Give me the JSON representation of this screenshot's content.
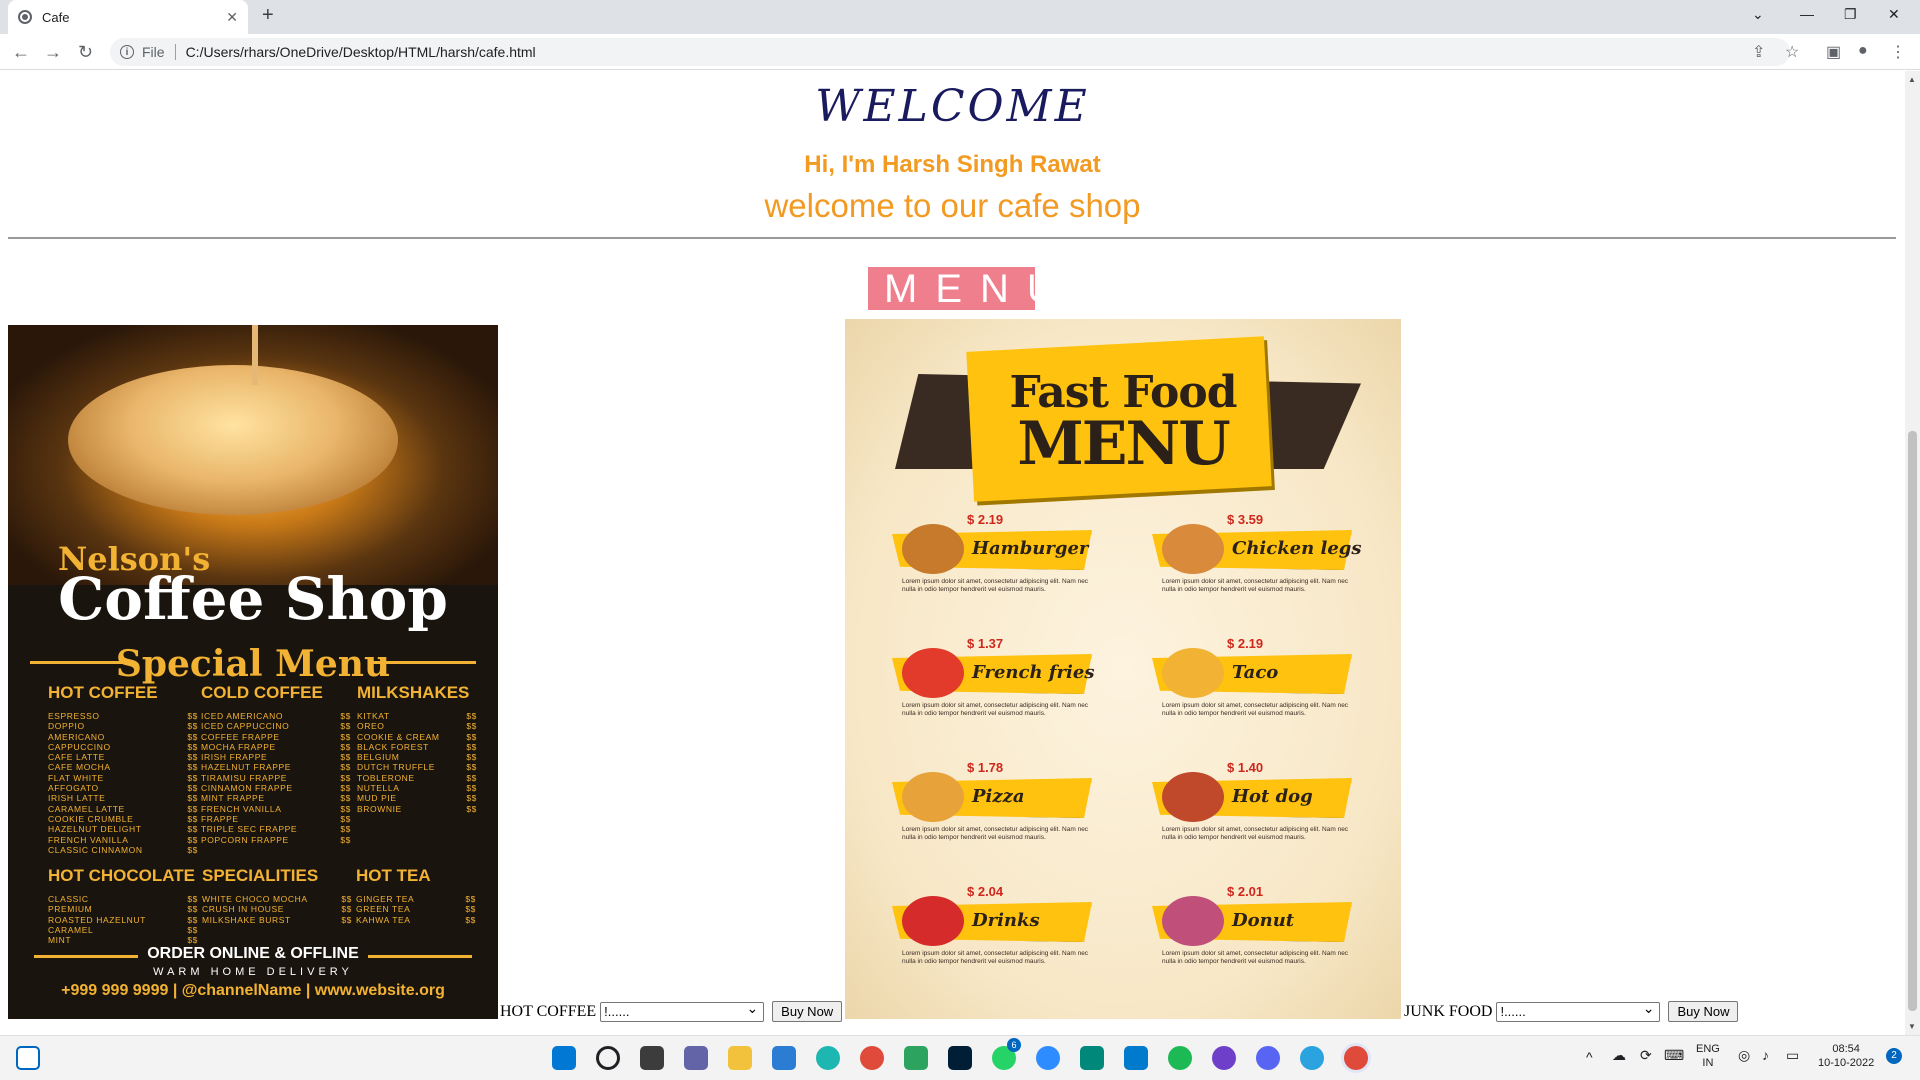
{
  "browser": {
    "tab_title": "Cafe",
    "new_tab": "+",
    "address_scheme": "File",
    "address_url": "C:/Users/rhars/OneDrive/Desktop/HTML/harsh/cafe.html"
  },
  "page": {
    "welcome": "WELCOME",
    "greeting": "Hi, I'm Harsh Singh Rawat",
    "subtitle": "welcome to our cafe shop",
    "menu_heading": "MENU"
  },
  "coffee_poster": {
    "brand": "Nelson's",
    "title": "Coffee Shop",
    "special": "Special Menu",
    "sections": [
      {
        "heading": "HOT COFFEE",
        "items": [
          "ESPRESSO",
          "DOPPIO",
          "AMERICANO",
          "CAPPUCCINO",
          "CAFE LATTE",
          "CAFE MOCHA",
          "FLAT WHITE",
          "AFFOGATO",
          "IRISH LATTE",
          "CARAMEL LATTE",
          "COOKIE CRUMBLE",
          "HAZELNUT DELIGHT",
          "FRENCH VANILLA",
          "CLASSIC CINNAMON"
        ]
      },
      {
        "heading": "COLD COFFEE",
        "items": [
          "ICED AMERICANO",
          "ICED CAPPUCCINO",
          "COFFEE FRAPPE",
          "MOCHA FRAPPE",
          "IRISH FRAPPE",
          "HAZELNUT FRAPPE",
          "TIRAMISU FRAPPE",
          "CINNAMON FRAPPE",
          "MINT FRAPPE",
          "FRENCH VANILLA",
          "FRAPPE",
          "TRIPLE SEC FRAPPE",
          "POPCORN FRAPPE"
        ]
      },
      {
        "heading": "MILKSHAKES",
        "items": [
          "KITKAT",
          "OREO",
          "COOKIE & CREAM",
          "BLACK FOREST",
          "BELGIUM",
          "DUTCH TRUFFLE",
          "TOBLERONE",
          "NUTELLA",
          "MUD PIE",
          "BROWNIE"
        ]
      },
      {
        "heading": "HOT CHOCOLATE",
        "items": [
          "CLASSIC",
          "PREMIUM",
          "ROASTED HAZELNUT",
          "CARAMEL",
          "MINT"
        ]
      },
      {
        "heading": "SPECIALITIES",
        "items": [
          "WHITE CHOCO MOCHA",
          "CRUSH IN HOUSE",
          "MILKSHAKE BURST"
        ]
      },
      {
        "heading": "HOT TEA",
        "items": [
          "GINGER TEA",
          "GREEN TEA",
          "KAHWA TEA"
        ]
      }
    ],
    "price_symbol": "$$",
    "order": "ORDER ONLINE & OFFLINE",
    "delivery": "WARM HOME DELIVERY",
    "contact": "+999 999 9999 | @channelName | www.website.org"
  },
  "fastfood_poster": {
    "title_line1": "Fast Food",
    "title_line2": "MENU",
    "items": [
      {
        "name": "Hamburger",
        "price": "$ 2.19",
        "pic_color": "#c77a2b"
      },
      {
        "name": "Chicken legs",
        "price": "$ 3.59",
        "pic_color": "#d98a3a"
      },
      {
        "name": "French fries",
        "price": "$ 1.37",
        "pic_color": "#e23b2b"
      },
      {
        "name": "Taco",
        "price": "$ 2.19",
        "pic_color": "#f2b233"
      },
      {
        "name": "Pizza",
        "price": "$ 1.78",
        "pic_color": "#e8a23a"
      },
      {
        "name": "Hot dog",
        "price": "$ 1.40",
        "pic_color": "#c0492b"
      },
      {
        "name": "Drinks",
        "price": "$ 2.04",
        "pic_color": "#d62b2b"
      },
      {
        "name": "Donut",
        "price": "$ 2.01",
        "pic_color": "#c0507a"
      }
    ],
    "lorem": "Lorem ipsum dolor sit amet, consectetur adipiscing elit. Nam nec nulla in odio tempor hendrerit vel euismod mauris."
  },
  "controls": {
    "hot_coffee_label": "HOT COFFEE",
    "hot_coffee_select": "!......",
    "junk_food_label": "JUNK FOOD",
    "junk_food_select": "!......",
    "buy_now": "Buy Now"
  },
  "taskbar": {
    "lang_top": "ENG",
    "lang_bottom": "IN",
    "time": "08:54",
    "date": "10-10-2022",
    "notification_count": "2",
    "whatsapp_badge": "6"
  },
  "colors": {
    "accent_orange": "#f29a21",
    "menu_pink": "#f07f8e",
    "welcome_navy": "#1a1a5e",
    "poster_gold": "#f2b233",
    "fast_yellow": "#ffc20e"
  }
}
